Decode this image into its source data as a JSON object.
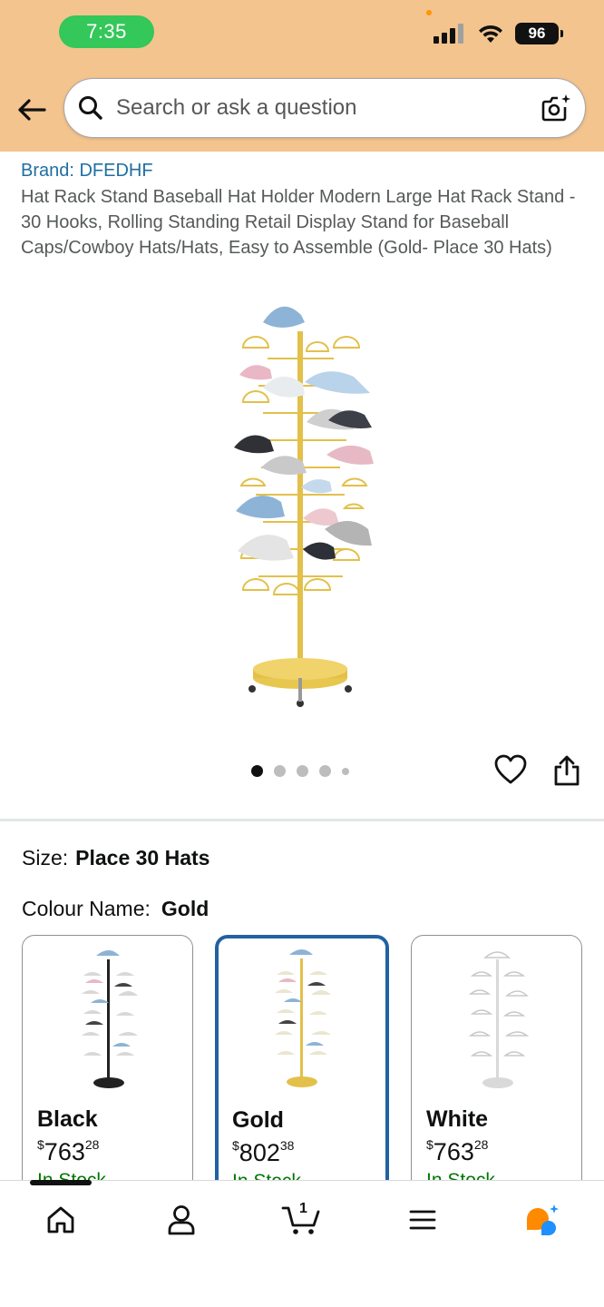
{
  "status_bar": {
    "time": "7:35",
    "battery": "96"
  },
  "search": {
    "placeholder": "Search or ask a question"
  },
  "product": {
    "brand": "Brand: DFEDHF",
    "title": "Hat Rack Stand Baseball Hat Holder Modern Large Hat Rack Stand - 30 Hooks, Rolling Standing Retail Display Stand for Baseball Caps/Cowboy Hats/Hats, Easy to Assemble (Gold- Place 30 Hats)",
    "image_count": 5,
    "active_image": 1
  },
  "size": {
    "label": "Size:",
    "value": "Place 30 Hats"
  },
  "colour": {
    "label": "Colour Name:",
    "value": "Gold",
    "options": [
      {
        "name": "Black",
        "currency": "$",
        "price_whole": "763",
        "price_fraction": "28",
        "stock": "In Stock",
        "pole_color": "#222222"
      },
      {
        "name": "Gold",
        "currency": "$",
        "price_whole": "802",
        "price_fraction": "38",
        "stock": "In Stock",
        "pole_color": "#e3c04a"
      },
      {
        "name": "White",
        "currency": "$",
        "price_whole": "763",
        "price_fraction": "28",
        "stock": "In Stock",
        "pole_color": "#d9d9d9"
      }
    ]
  },
  "bottom_nav": {
    "cart_count": "1",
    "items": [
      "home-icon",
      "account-icon",
      "cart-icon",
      "menu-icon",
      "rufus-icon"
    ]
  },
  "colors": {
    "header_bg": "#f3c48e",
    "link_blue": "#1f6ea3",
    "selected_border": "#2162a1",
    "time_pill": "#34c759",
    "stock_green": "#007600",
    "gold": "#e3c04a"
  }
}
